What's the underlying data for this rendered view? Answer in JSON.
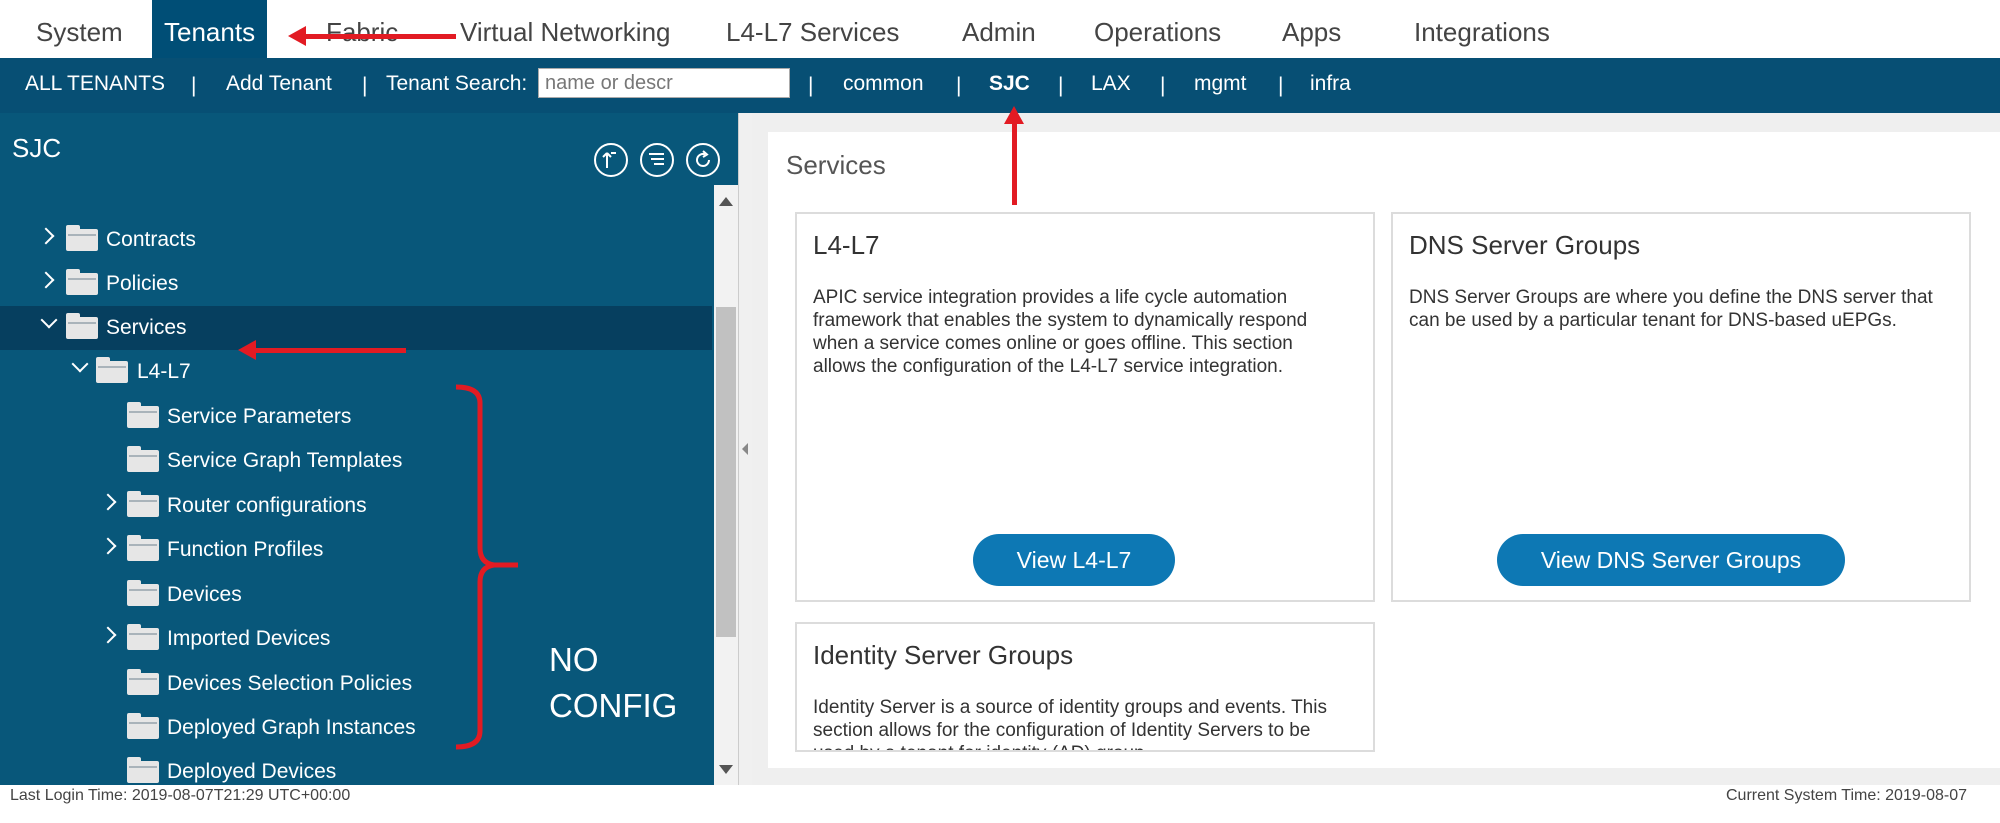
{
  "top_nav": {
    "tabs": [
      {
        "label": "System"
      },
      {
        "label": "Tenants"
      },
      {
        "label": "Fabric"
      },
      {
        "label": "Virtual Networking"
      },
      {
        "label": "L4-L7 Services"
      },
      {
        "label": "Admin"
      },
      {
        "label": "Operations"
      },
      {
        "label": "Apps"
      },
      {
        "label": "Integrations"
      }
    ],
    "active_tab": "Tenants"
  },
  "sub_nav": {
    "all_tenants": "ALL TENANTS",
    "add_tenant": "Add Tenant",
    "search_label": "Tenant Search:",
    "search_placeholder": "name or descr",
    "separator": "|",
    "tenants": [
      {
        "label": "common"
      },
      {
        "label": "SJC"
      },
      {
        "label": "LAX"
      },
      {
        "label": "mgmt"
      },
      {
        "label": "infra"
      }
    ],
    "active_tenant": "SJC"
  },
  "tree": {
    "title": "SJC",
    "items": [
      {
        "label": "Contracts"
      },
      {
        "label": "Policies"
      },
      {
        "label": "Services"
      },
      {
        "label": "L4-L7"
      },
      {
        "label": "Service Parameters"
      },
      {
        "label": "Service Graph Templates"
      },
      {
        "label": "Router configurations"
      },
      {
        "label": "Function Profiles"
      },
      {
        "label": "Devices"
      },
      {
        "label": "Imported Devices"
      },
      {
        "label": "Devices Selection Policies"
      },
      {
        "label": "Deployed Graph Instances"
      },
      {
        "label": "Deployed Devices"
      }
    ]
  },
  "main": {
    "title": "Services",
    "cards": [
      {
        "title": "L4-L7",
        "description": "APIC service integration provides a life cycle automation framework that enables the system to dynamically respond when a service comes online or goes offline. This section allows the configuration of the L4-L7 service integration.",
        "button": "View L4-L7"
      },
      {
        "title": "DNS Server Groups",
        "description": "DNS Server Groups are where you define the DNS server that can be used by a particular tenant for DNS-based uEPGs.",
        "button": "View DNS Server Groups"
      },
      {
        "title": "Identity Server Groups",
        "description": "Identity Server is a source of identity groups and events. This section allows for the configuration of Identity Servers to be used by a tenant for identity (AD) group"
      }
    ]
  },
  "annotation": {
    "note": "NO\nCONFIG",
    "color": "#e21b23"
  },
  "footer": {
    "last_login": "Last Login Time: 2019-08-07T21:29 UTC+00:00",
    "current_time": "Current System Time: 2019-08-07"
  },
  "colors": {
    "nav_bar": "#074f74",
    "tree_bg": "#08577a",
    "button": "#0d78b4"
  }
}
